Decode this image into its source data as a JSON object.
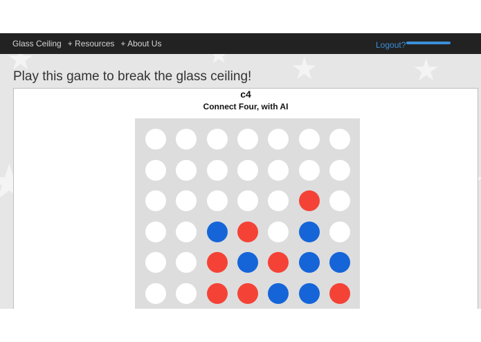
{
  "nav": {
    "brand": "Glass Ceiling",
    "resources": "+ Resources",
    "about": "+ About Us",
    "logout": "Logout?"
  },
  "page": {
    "heading": "Play this game to break the glass ceiling!"
  },
  "game": {
    "title": "c4",
    "subtitle": "Connect Four, with AI",
    "colors": {
      "empty": "#ffffff",
      "red": "#f44336",
      "blue": "#1565d8",
      "board": "#dddddd"
    },
    "board": [
      [
        "empty",
        "empty",
        "empty",
        "empty",
        "empty",
        "empty",
        "empty"
      ],
      [
        "empty",
        "empty",
        "empty",
        "empty",
        "empty",
        "empty",
        "empty"
      ],
      [
        "empty",
        "empty",
        "empty",
        "empty",
        "empty",
        "red",
        "empty"
      ],
      [
        "empty",
        "empty",
        "blue",
        "red",
        "empty",
        "blue",
        "empty"
      ],
      [
        "empty",
        "empty",
        "red",
        "blue",
        "red",
        "blue",
        "blue"
      ],
      [
        "empty",
        "empty",
        "red",
        "red",
        "blue",
        "blue",
        "red"
      ]
    ]
  }
}
